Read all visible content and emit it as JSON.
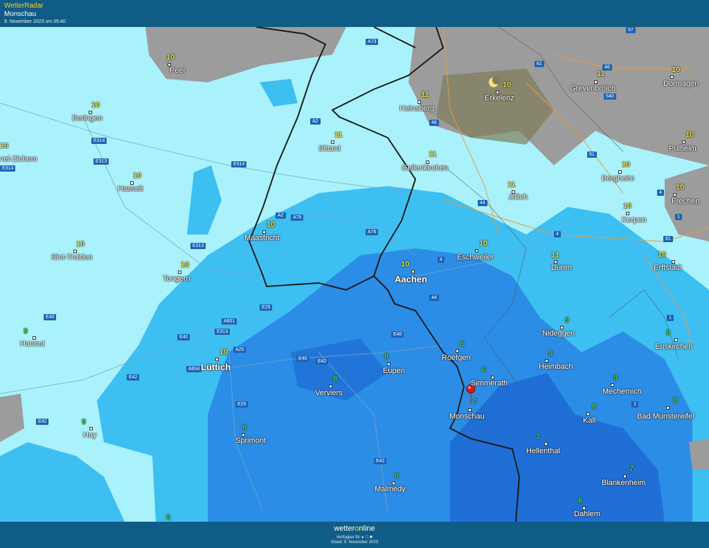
{
  "header": {
    "brand": "WetterRadar",
    "location": "Monschau",
    "timestamp": "9. November 2023 um 05:40"
  },
  "footer": {
    "logo_a": "wetter",
    "logo_o": "o",
    "logo_b": "nline",
    "available": "Verfügbar für",
    "platform_icons": [
      "android-icon",
      "apple-icon",
      "web-icon"
    ],
    "stand": "Stand: 9. November 2023"
  },
  "colors": {
    "light_precip": "#a9f2fb",
    "medium_precip": "#3dbff2",
    "heavy_precip": "#2c8de6",
    "very_heavy_precip": "#1f6fd6",
    "clouds": "#9c9c9c",
    "temp_10_11": "#e7e34a",
    "temp_6_9": "#52d94a"
  },
  "cities": [
    {
      "id": "peer",
      "name": "Peer",
      "temp": "10"
    },
    {
      "id": "beringen",
      "name": "Beringen",
      "temp": "10"
    },
    {
      "id": "zichem",
      "name": "vel-Zichem",
      "temp": "10"
    },
    {
      "id": "hasselt",
      "name": "Hasselt",
      "temp": "10"
    },
    {
      "id": "sint-truiden",
      "name": "Sint-Truiden",
      "temp": "10"
    },
    {
      "id": "tongern",
      "name": "Tongern",
      "temp": "10"
    },
    {
      "id": "hannut",
      "name": "Hannut",
      "temp": "9"
    },
    {
      "id": "huy",
      "name": "Huy",
      "temp": "9"
    },
    {
      "id": "luettich",
      "name": "Lüttich",
      "temp": "10"
    },
    {
      "id": "maastricht",
      "name": "Maastricht",
      "temp": "10"
    },
    {
      "id": "sittard",
      "name": "Sittard",
      "temp": "11"
    },
    {
      "id": "heinsberg",
      "name": "Heinsberg",
      "temp": "11"
    },
    {
      "id": "erkelenz",
      "name": "Erkelenz",
      "temp": "10"
    },
    {
      "id": "grevenbroich",
      "name": "Grevenbroich",
      "temp": "11"
    },
    {
      "id": "dormagen",
      "name": "Dormagen",
      "temp": "10"
    },
    {
      "id": "geilenkirchen",
      "name": "Geilenkirchen",
      "temp": "11"
    },
    {
      "id": "juelich",
      "name": "Jülich",
      "temp": "11"
    },
    {
      "id": "pulheim",
      "name": "Pulheim",
      "temp": "10"
    },
    {
      "id": "bergheim",
      "name": "Bergheim",
      "temp": "10"
    },
    {
      "id": "frechen",
      "name": "Frechen",
      "temp": "10"
    },
    {
      "id": "kerpen",
      "name": "Kerpen",
      "temp": "10"
    },
    {
      "id": "eschweiler",
      "name": "Eschweiler",
      "temp": "10"
    },
    {
      "id": "aachen",
      "name": "Aachen",
      "temp": "10"
    },
    {
      "id": "dueren",
      "name": "Düren",
      "temp": "11"
    },
    {
      "id": "erftstadt",
      "name": "Erftstadt",
      "temp": "10"
    },
    {
      "id": "nideggen",
      "name": "Nideggen",
      "temp": "9"
    },
    {
      "id": "euskirchen",
      "name": "Euskirchen",
      "temp": "9"
    },
    {
      "id": "roetgen",
      "name": "Roetgen",
      "temp": "6"
    },
    {
      "id": "heimbach",
      "name": "Heimbach",
      "temp": "9"
    },
    {
      "id": "simmerath",
      "name": "Simmerath",
      "temp": "6"
    },
    {
      "id": "monschau",
      "name": "Monschau",
      "temp": "7"
    },
    {
      "id": "mechernich",
      "name": "Mechernich",
      "temp": "8"
    },
    {
      "id": "kall",
      "name": "Kall",
      "temp": "8"
    },
    {
      "id": "bad-muenstereifel",
      "name": "Bad Münstereifel",
      "temp": "8"
    },
    {
      "id": "hellenthal",
      "name": "Hellenthal",
      "temp": "7"
    },
    {
      "id": "blankenheim",
      "name": "Blankenheim",
      "temp": "7"
    },
    {
      "id": "dahlem",
      "name": "Dahlem",
      "temp": "6"
    },
    {
      "id": "eupen",
      "name": "Eupen",
      "temp": "8"
    },
    {
      "id": "verviers",
      "name": "Verviers",
      "temp": "8"
    },
    {
      "id": "sprimont",
      "name": "Sprimont",
      "temp": "8"
    },
    {
      "id": "malmedy",
      "name": "Malmedy",
      "temp": "8"
    }
  ],
  "extra_temps": [
    {
      "id": "bottom-left",
      "temp": "8"
    }
  ],
  "roads": [
    "A73",
    "A2",
    "E314",
    "E313",
    "E314",
    "E314",
    "A2",
    "A79",
    "A76",
    "E313",
    "E40",
    "E25",
    "A601",
    "E313",
    "E40",
    "A25",
    "E40",
    "E42",
    "A604",
    "E42",
    "E25",
    "E42",
    "E42",
    "E40",
    "46",
    "61",
    "46",
    "540",
    "57",
    "61",
    "44",
    "4",
    "4",
    "44",
    "4",
    "61",
    "1",
    "1",
    "1",
    "4"
  ]
}
